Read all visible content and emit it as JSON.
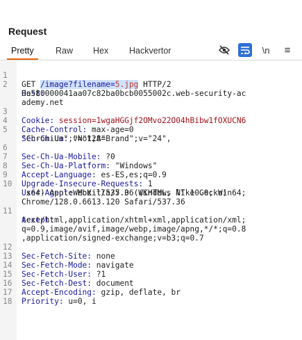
{
  "panel": {
    "title": "Request"
  },
  "tabs": [
    "Pretty",
    "Raw",
    "Hex",
    "Hackvertor"
  ],
  "toolbar": {
    "newline_label": "\\n",
    "menu_label": "≡"
  },
  "request": {
    "method": "GET ",
    "path": "/image?filename=",
    "filename": "5.jpg",
    "protocol": " HTTP/2",
    "host_key": "Host:",
    "host_val": "0a580000041aa07c82ba0bcb0055002c.web-security-ac",
    "host_val2": "ademy.net",
    "cookie_key": "Cookie:",
    "cookie_val": " session=1wgaHGGjf2OMvo22O04hBibw1fOXUCN6",
    "cc_key": "Cache-Control:",
    "cc_val": " max-age=0",
    "ua_ch_key": "Sec-Ch-Ua:",
    "ua_ch_val": " \"Not;A=Brand\";v=\"24\",",
    "ua_ch_val2": "\"Chromium\";v=\"128\"",
    "mobile_key": "Sec-Ch-Ua-Mobile:",
    "mobile_val": " ?0",
    "platform_key": "Sec-Ch-Ua-Platform:",
    "platform_val": " \"Windows\"",
    "lang_key": "Accept-Language:",
    "lang_val": " es-ES,es;q=0.9",
    "upg_key": "Upgrade-Insecure-Requests:",
    "upg_val": " 1",
    "ua_key": "User-Agent:",
    "ua_val": " Mozilla/5.0 (Windows NT 10.0; Win64;",
    "ua_val2": " x64) AppleWebKit/537.36 (KHTML, like Gecko)",
    "ua_val3": "Chrome/128.0.6613.120 Safari/537.36",
    "accept_key": "Accept:",
    "accept_val": "text/html,application/xhtml+xml,application/xml;",
    "accept_val2": "q=0.9,image/avif,image/webp,image/apng,*/*;q=0.8",
    "accept_val3": ",application/signed-exchange;v=b3;q=0.7",
    "site_key": "Sec-Fetch-Site:",
    "site_val": " none",
    "mode_key": "Sec-Fetch-Mode:",
    "mode_val": " navigate",
    "user_key": "Sec-Fetch-User:",
    "user_val": " ?1",
    "dest_key": "Sec-Fetch-Dest:",
    "dest_val": " document",
    "enc_key": "Accept-Encoding:",
    "enc_val": " gzip, deflate, br",
    "prio_key": "Priority:",
    "prio_val": " u=0, i"
  },
  "line_numbers": [
    "1",
    "2",
    "3",
    "4",
    "5",
    "6",
    "7",
    "8",
    "9",
    "10",
    "11",
    "12",
    "13",
    "14",
    "15",
    "16",
    "17",
    "18"
  ]
}
